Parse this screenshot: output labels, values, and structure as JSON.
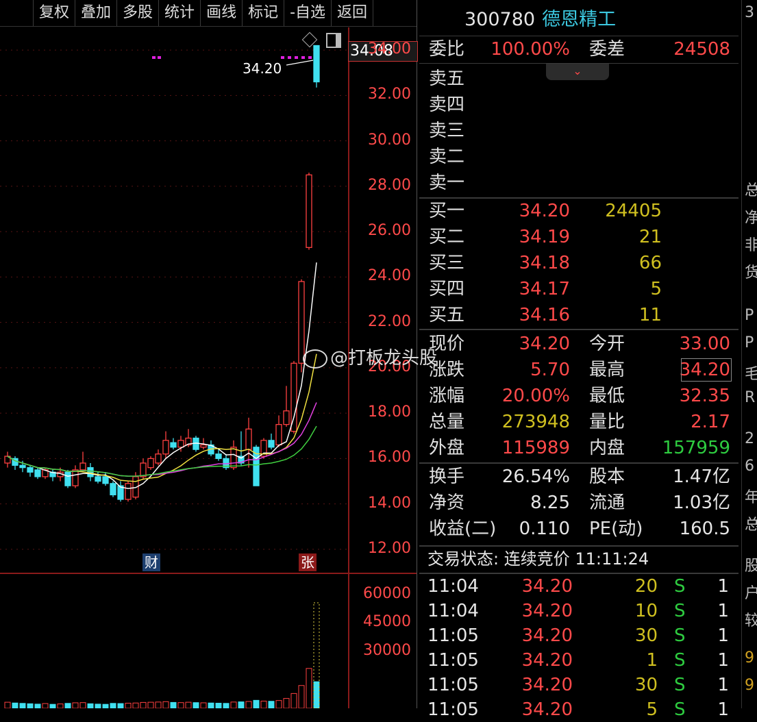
{
  "toolbar": {
    "buttons": [
      "复权",
      "叠加",
      "多股",
      "统计",
      "画线",
      "标记",
      "-自选",
      "返回"
    ]
  },
  "stock": {
    "code": "300780",
    "name": "德恩精工"
  },
  "chart": {
    "price_tag": "34.08",
    "last_label": "34.20",
    "y_labels": [
      "34.00",
      "32.00",
      "30.00",
      "28.00",
      "26.00",
      "24.00",
      "22.00",
      "20.00",
      "18.00",
      "16.00",
      "14.00",
      "12.00"
    ],
    "tag_cai": "财",
    "tag_zhang": "张",
    "vol_labels": [
      "60000",
      "45000",
      "30000"
    ],
    "watermark": "@打板龙头股"
  },
  "chart_data": {
    "type": "candlestick",
    "ylim": [
      11,
      35
    ],
    "candles": [
      [
        15.8,
        16.1,
        16.3,
        15.6
      ],
      [
        16.0,
        15.7,
        16.1,
        15.5
      ],
      [
        15.7,
        15.6,
        15.9,
        15.4
      ],
      [
        15.6,
        15.4,
        15.7,
        15.2
      ],
      [
        15.5,
        15.2,
        15.6,
        15.1
      ],
      [
        15.2,
        15.5,
        15.6,
        15.1
      ],
      [
        15.4,
        15.2,
        15.5,
        15.0
      ],
      [
        15.2,
        15.4,
        15.6,
        15.0
      ],
      [
        15.4,
        14.8,
        15.5,
        14.7
      ],
      [
        14.8,
        15.5,
        15.7,
        14.7
      ],
      [
        15.5,
        15.8,
        16.3,
        15.4
      ],
      [
        15.6,
        15.2,
        15.8,
        15.0
      ],
      [
        15.2,
        15.0,
        15.4,
        14.9
      ],
      [
        15.2,
        14.9,
        15.4,
        14.8
      ],
      [
        14.9,
        14.4,
        15.0,
        14.3
      ],
      [
        14.8,
        14.2,
        15.0,
        14.1
      ],
      [
        14.2,
        14.9,
        15.0,
        14.1
      ],
      [
        14.3,
        15.2,
        15.4,
        14.2
      ],
      [
        15.2,
        15.8,
        16.0,
        15.1
      ],
      [
        15.6,
        16.0,
        16.1,
        15.5
      ],
      [
        15.8,
        16.2,
        16.4,
        15.7
      ],
      [
        16.2,
        16.8,
        17.2,
        16.0
      ],
      [
        16.7,
        16.5,
        16.9,
        16.4
      ],
      [
        16.5,
        16.8,
        17.0,
        16.3
      ],
      [
        16.6,
        16.9,
        17.3,
        16.5
      ],
      [
        16.9,
        16.4,
        17.0,
        16.3
      ],
      [
        16.5,
        16.6,
        16.9,
        16.4
      ],
      [
        16.6,
        16.2,
        16.8,
        16.1
      ],
      [
        16.2,
        16.0,
        16.4,
        15.9
      ],
      [
        16.0,
        15.6,
        16.2,
        15.5
      ],
      [
        15.6,
        16.5,
        16.8,
        15.5
      ],
      [
        16.1,
        15.8,
        17.2,
        15.7
      ],
      [
        16.4,
        17.3,
        17.8,
        15.6
      ],
      [
        16.5,
        14.8,
        16.6,
        14.8
      ],
      [
        16.1,
        16.8,
        16.9,
        16.0
      ],
      [
        16.8,
        16.5,
        17.1,
        16.4
      ],
      [
        16.6,
        17.5,
        17.9,
        16.5
      ],
      [
        17.5,
        18.1,
        19.2,
        17.4
      ],
      [
        17.2,
        20.2,
        20.3,
        17.1
      ],
      [
        20.2,
        23.8,
        23.9,
        19.8
      ],
      [
        25.3,
        28.5,
        28.6,
        25.2
      ],
      [
        34.2,
        32.6,
        34.2,
        32.35
      ]
    ],
    "vol": [
      3200,
      2800,
      2600,
      2400,
      2200,
      2500,
      2100,
      2300,
      2600,
      2900,
      3000,
      2400,
      2200,
      2100,
      2600,
      2500,
      2700,
      2800,
      3100,
      3200,
      3300,
      3500,
      3100,
      3000,
      3200,
      3000,
      2900,
      2800,
      2700,
      2600,
      3300,
      3400,
      3600,
      4200,
      3800,
      3700,
      4100,
      5200,
      7800,
      12000,
      21000,
      14000
    ]
  },
  "panel": {
    "weibi_label": "委比",
    "weibi_value": "100.00%",
    "weicha_label": "委差",
    "weicha_value": "24508",
    "sell": [
      {
        "label": "卖五"
      },
      {
        "label": "卖四"
      },
      {
        "label": "卖三"
      },
      {
        "label": "卖二"
      },
      {
        "label": "卖一"
      }
    ],
    "buy": [
      {
        "label": "买一",
        "price": "34.20",
        "vol": "24405"
      },
      {
        "label": "买二",
        "price": "34.19",
        "vol": "21"
      },
      {
        "label": "买三",
        "price": "34.18",
        "vol": "66"
      },
      {
        "label": "买四",
        "price": "34.17",
        "vol": "5"
      },
      {
        "label": "买五",
        "price": "34.16",
        "vol": "11"
      }
    ],
    "stats": [
      {
        "l1": "现价",
        "v1": "34.20",
        "l2": "今开",
        "v2": "33.00"
      },
      {
        "l1": "涨跌",
        "v1": "5.70",
        "l2": "最高",
        "v2": "34.20"
      },
      {
        "l1": "涨幅",
        "v1": "20.00%",
        "l2": "最低",
        "v2": "32.35"
      },
      {
        "l1": "总量",
        "v1": "273948",
        "l2": "量比",
        "v2": "2.17"
      },
      {
        "l1": "外盘",
        "v1": "115989",
        "l2": "内盘",
        "v2": "157959"
      }
    ],
    "fund": [
      {
        "l1": "换手",
        "v1": "26.54%",
        "l2": "股本",
        "v2": "1.47亿"
      },
      {
        "l1": "净资",
        "v1": "8.25",
        "l2": "流通",
        "v2": "1.03亿"
      },
      {
        "l1": "收益(二)",
        "v1": "0.110",
        "l2": "PE(动)",
        "v2": "160.5"
      }
    ],
    "status": "交易状态: 连续竞价 11:11:24",
    "ticks": [
      {
        "t": "11:04",
        "p": "34.20",
        "v": "20",
        "s": "S",
        "n": "1"
      },
      {
        "t": "11:04",
        "p": "34.20",
        "v": "10",
        "s": "S",
        "n": "1"
      },
      {
        "t": "11:05",
        "p": "34.20",
        "v": "30",
        "s": "S",
        "n": "1"
      },
      {
        "t": "11:05",
        "p": "34.20",
        "v": "1",
        "s": "S",
        "n": "1"
      },
      {
        "t": "11:05",
        "p": "34.20",
        "v": "30",
        "s": "S",
        "n": "1"
      },
      {
        "t": "11:05",
        "p": "34.20",
        "v": "5",
        "s": "S",
        "n": "1"
      }
    ]
  },
  "edge": [
    "3",
    "总",
    "净",
    "非",
    "货",
    "P",
    "P",
    "毛",
    "R",
    "2",
    "6",
    "年",
    "总",
    "股",
    "户",
    "较",
    "9",
    "9"
  ]
}
